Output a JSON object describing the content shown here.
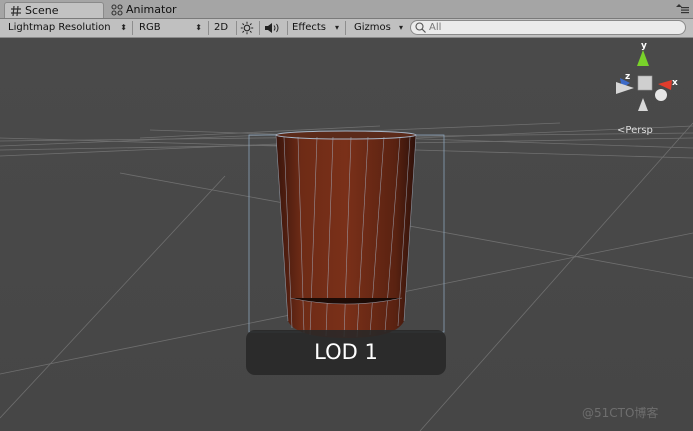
{
  "tabs": {
    "scene_label": "Scene",
    "animator_label": "Animator"
  },
  "toolbar": {
    "render_mode": "Lightmap Resolution",
    "color_mode": "RGB",
    "toggle_2d": "2D",
    "effects_label": "Effects",
    "gizmos_label": "Gizmos",
    "search_placeholder": "All"
  },
  "gizmo": {
    "y_label": "y",
    "x_label": "x",
    "z_label": "z",
    "projection_label": "Persp"
  },
  "lod_label": "LOD 1",
  "watermark": "@51CTO博客",
  "colors": {
    "viewport": "#494949",
    "toolbar": "#c0c0c0",
    "barrel": "#6b2615",
    "y_axis": "#79d22a",
    "x_axis": "#e03c2c",
    "z_axis": "#3d6ac8"
  },
  "icons": {
    "scene_tab": "hash-icon",
    "animator_tab": "animator-icon",
    "lighting": "sun-icon",
    "audio": "speaker-icon",
    "search": "search-icon",
    "window_menu": "menu-icon"
  }
}
